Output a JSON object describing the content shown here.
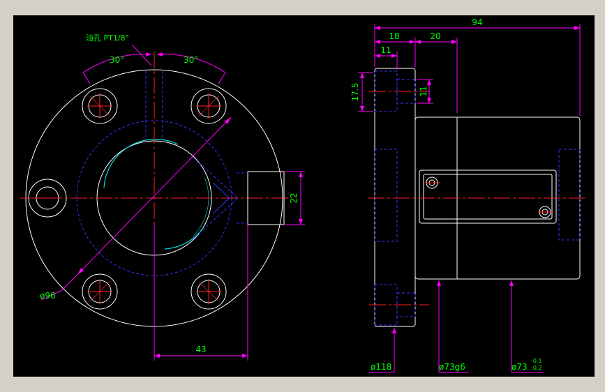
{
  "colors": {
    "background": "#000000",
    "outline": "#ffffff",
    "hidden": "#3333ff",
    "center": "#ff2020",
    "dimension": "#ff00ff",
    "text": "#00ff00",
    "thread": "#00e0e0"
  },
  "front_view": {
    "oil_hole_label": "油孔 PT1/8\"",
    "angle_left": "30°",
    "angle_right": "30°",
    "pcd_label": "ø96",
    "width_22": "22",
    "offset_43": "43"
  },
  "side_view": {
    "overall_94": "94",
    "dim_18": "18",
    "dim_20": "20",
    "dim_11_top": "11",
    "dim_17_5": "17.5",
    "dim_11_side": "11",
    "dia_118": "ø118",
    "dia_73g6": "ø73g6",
    "dia_73_tol": "ø73",
    "tol_upper": "-0.1",
    "tol_lower": "-0.2"
  }
}
